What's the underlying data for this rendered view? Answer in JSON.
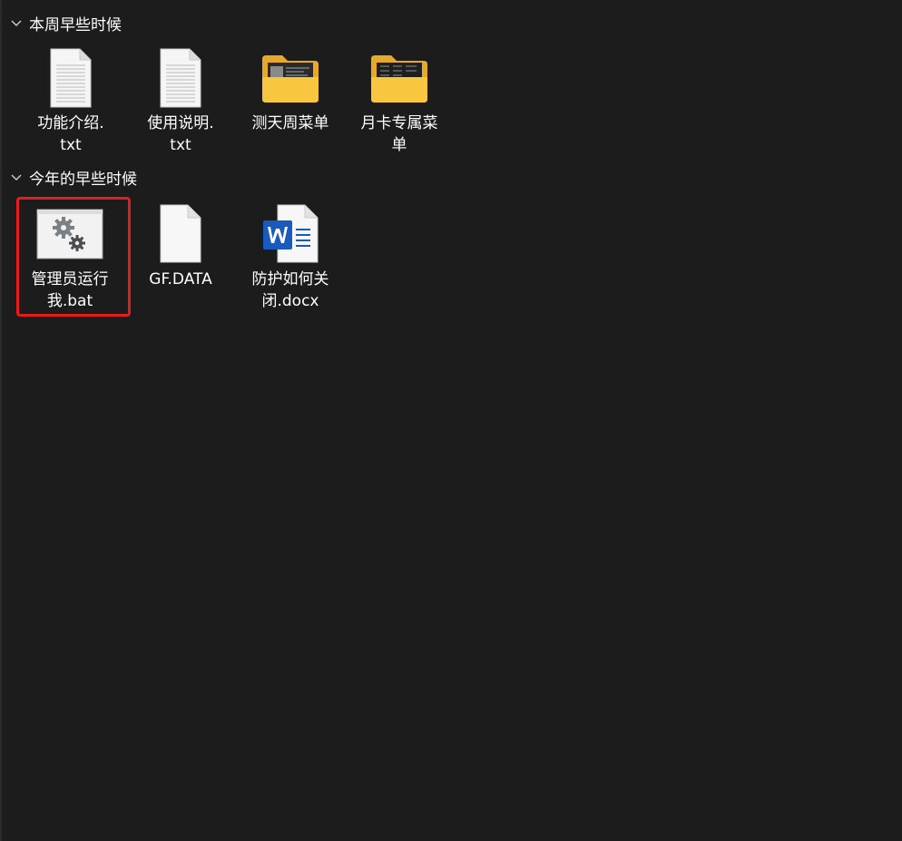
{
  "groups": [
    {
      "title": "本周早些时候",
      "items": [
        {
          "icon": "text-file-icon",
          "name_line1": "功能介绍.",
          "name_line2": "txt"
        },
        {
          "icon": "text-file-icon",
          "name_line1": "使用说明.",
          "name_line2": "txt"
        },
        {
          "icon": "folder-icon",
          "name_line1": "测天周菜单",
          "name_line2": ""
        },
        {
          "icon": "folder-icon",
          "name_line1": "月卡专属菜",
          "name_line2": "单"
        }
      ]
    },
    {
      "title": "今年的早些时候",
      "items": [
        {
          "icon": "batch-file-icon",
          "name_line1": "管理员运行",
          "name_line2": "我.bat"
        },
        {
          "icon": "blank-file-icon",
          "name_line1": "GF.DATA",
          "name_line2": ""
        },
        {
          "icon": "word-document-icon",
          "name_line1": "防护如何关",
          "name_line2": "闭.docx"
        }
      ]
    }
  ],
  "colors": {
    "background": "#1c1c1c",
    "highlight": "#e51c1c",
    "folder": "#f8c73f",
    "word_blue": "#185abd"
  }
}
